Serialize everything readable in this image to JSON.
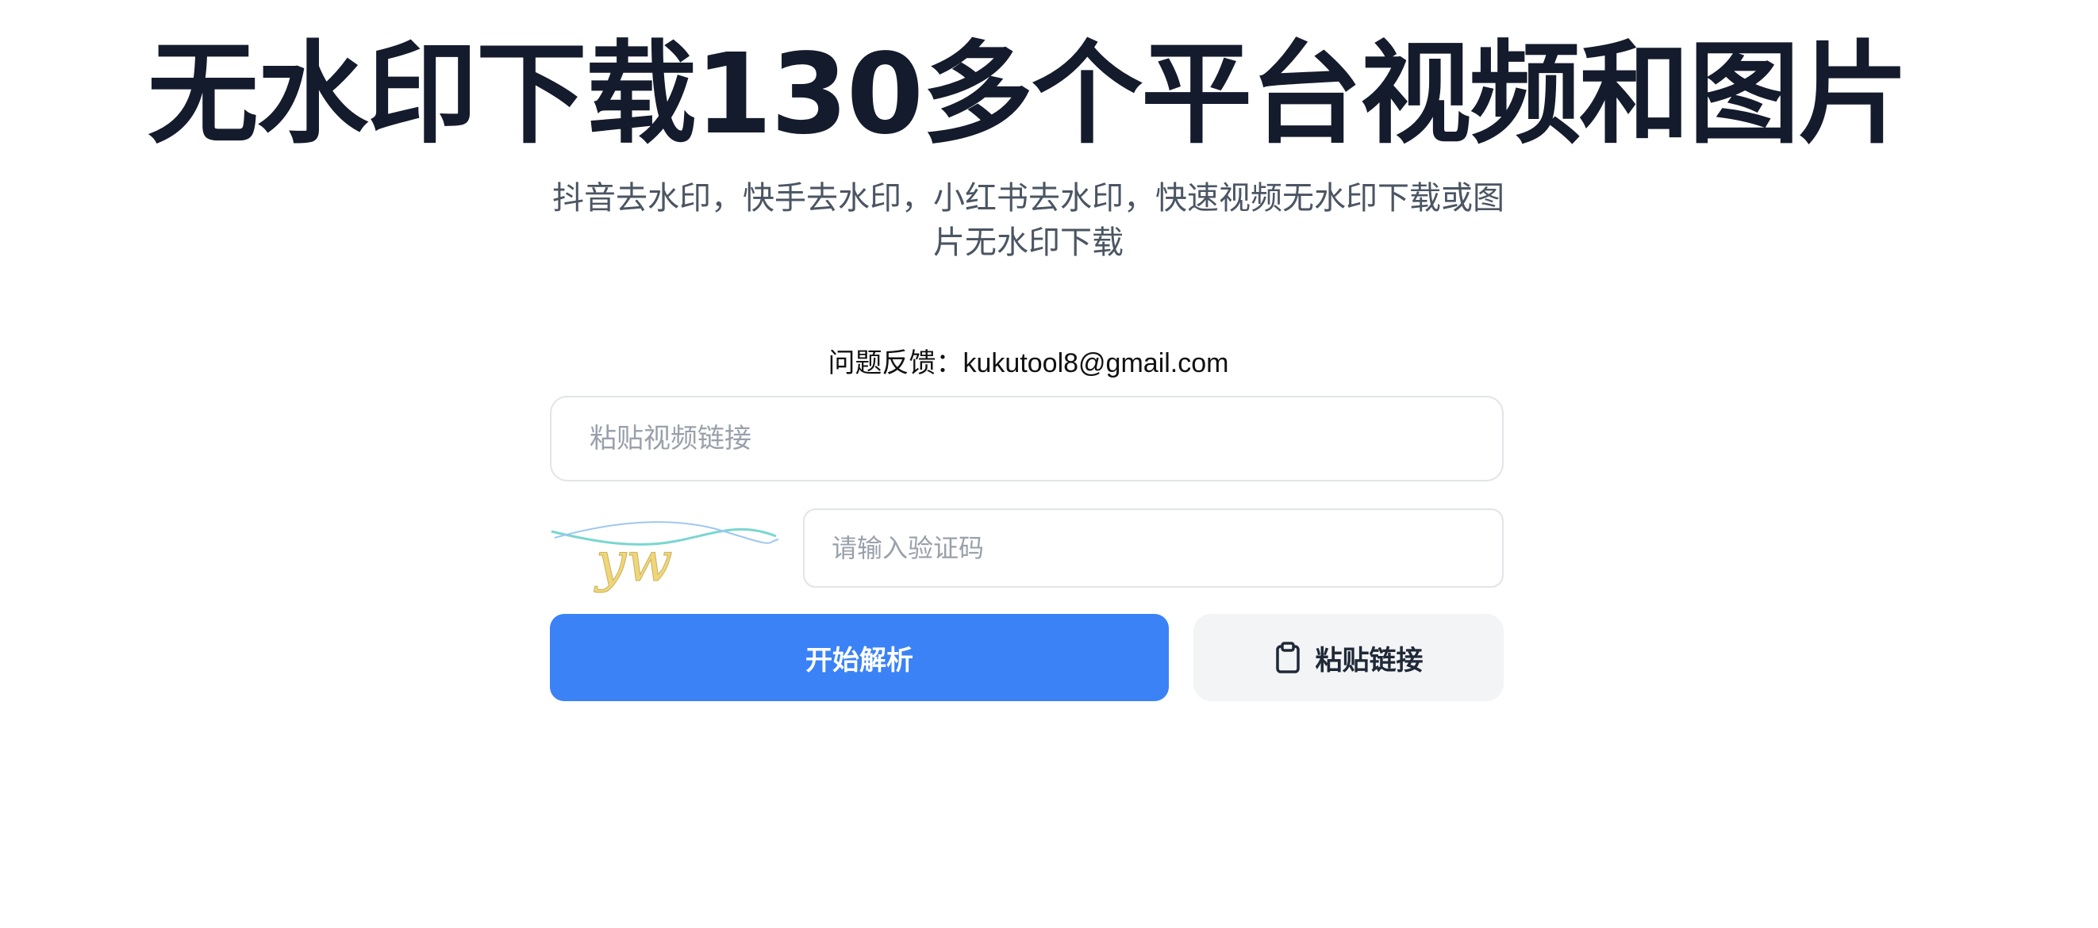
{
  "hero": {
    "title": "无水印下载130多个平台视频和图片",
    "subtitle": "抖音去水印，快手去水印，小红书去水印，快速视频无水印下载或图片无水印下载"
  },
  "feedback": {
    "label": "问题反馈：",
    "email": "kukutool8@gmail.com"
  },
  "form": {
    "link_placeholder": "粘贴视频链接",
    "link_value": "",
    "captcha_text": "yw",
    "captcha_placeholder": "请输入验证码",
    "captcha_value": "",
    "start_label": "开始解析",
    "paste_label": "粘贴链接",
    "paste_icon": "clipboard-icon"
  },
  "colors": {
    "primary": "#3b82f6",
    "title": "#141b2c",
    "subtitle": "#4b5563",
    "secondary_bg": "#f3f4f6",
    "border": "#e2e4e9"
  }
}
